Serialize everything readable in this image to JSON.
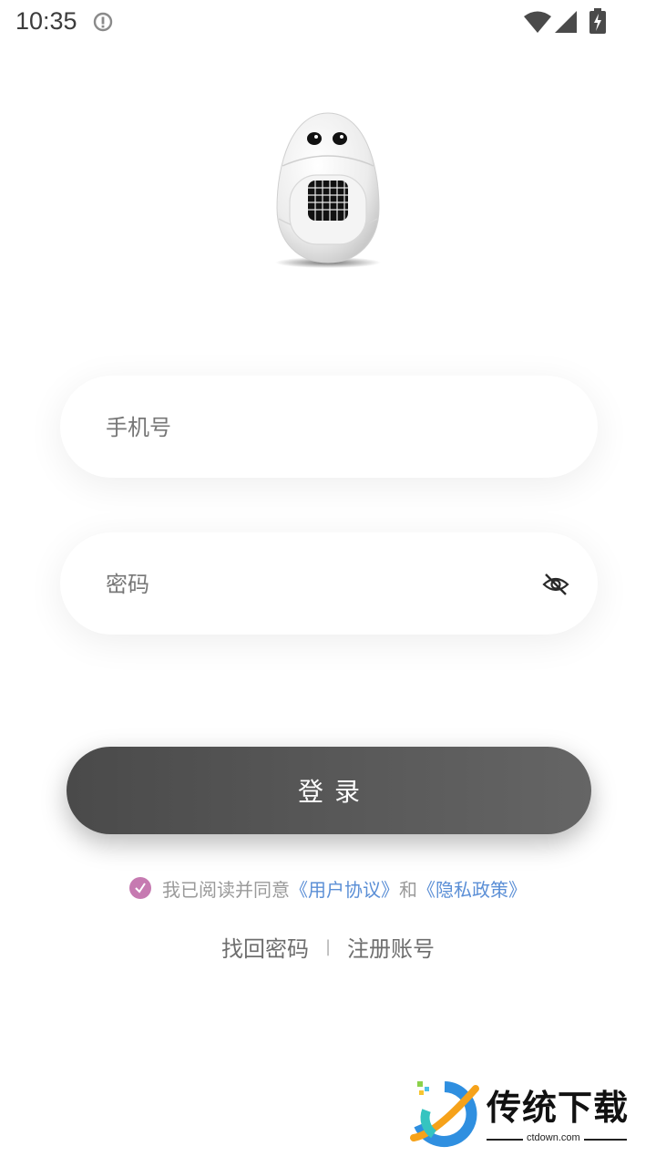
{
  "status_bar": {
    "time": "10:35",
    "icons": [
      "info-icon",
      "wifi-icon",
      "signal-icon",
      "battery-charging-icon"
    ]
  },
  "mascot": {
    "icon": "egg-robot-mascot"
  },
  "form": {
    "phone": {
      "placeholder": "手机号",
      "value": ""
    },
    "password": {
      "placeholder": "密码",
      "value": "",
      "toggle_icon": "eye-off-icon"
    },
    "login_label": "登录"
  },
  "agreement": {
    "checked": true,
    "text": "我已阅读并同意",
    "terms_link": "《用户协议》",
    "connector": "和",
    "privacy_link": "《隐私政策》"
  },
  "links": {
    "recover_password": "找回密码",
    "separator": "|",
    "register": "注册账号"
  },
  "watermark": {
    "title": "传统下载",
    "subtitle": "ctdown.com"
  },
  "colors": {
    "accent_check": "#c67ab1",
    "link": "#5b8fd6",
    "button_start": "#4a4a4a",
    "button_end": "#656565"
  }
}
